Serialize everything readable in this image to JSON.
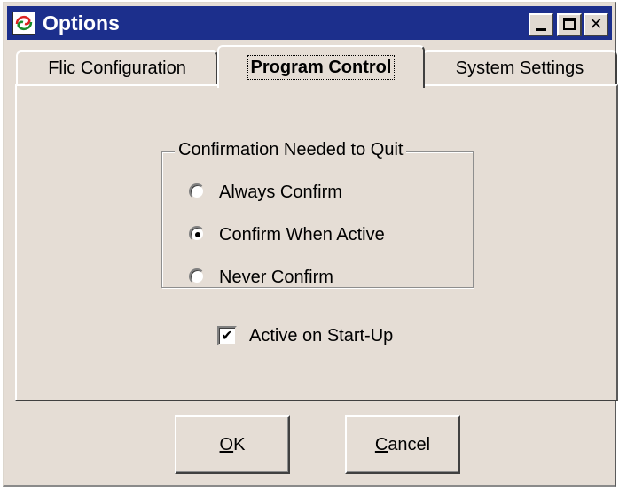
{
  "window": {
    "title": "Options",
    "minimize_glyph": "_",
    "maximize_glyph": "□",
    "close_glyph": "✕"
  },
  "tabs": [
    {
      "label": "Flic Configuration",
      "active": false
    },
    {
      "label": "Program Control",
      "active": true
    },
    {
      "label": "System Settings",
      "active": false
    }
  ],
  "group": {
    "title": "Confirmation Needed to Quit",
    "options": [
      {
        "label": "Always Confirm",
        "selected": false
      },
      {
        "label": "Confirm When Active",
        "selected": true
      },
      {
        "label": "Never Confirm",
        "selected": false
      }
    ]
  },
  "checkbox": {
    "label": "Active on Start-Up",
    "checked": true,
    "check_glyph": "✔"
  },
  "buttons": {
    "ok_mnemonic": "O",
    "ok_rest": "K",
    "cancel_mnemonic": "C",
    "cancel_rest": "ancel"
  },
  "colors": {
    "titlebar": "#1c2f8c",
    "face": "#e5ddd5"
  },
  "icons": {
    "app": "app-swirl-icon",
    "radio": "radio-icon",
    "checkbox": "checkmark-icon"
  }
}
